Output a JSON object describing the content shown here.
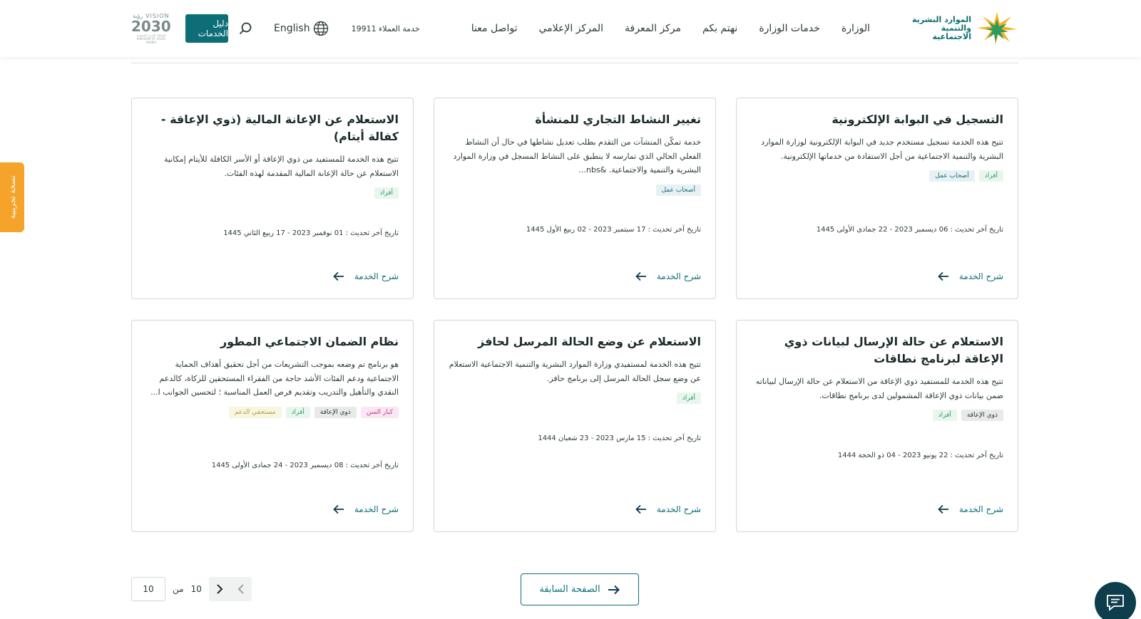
{
  "header": {
    "logo_text_line1": "الموارد البشرية",
    "logo_text_line2": "والتنمية الاجتماعية",
    "nav": [
      "الوزارة",
      "خدمات الوزارة",
      "نهتم بكم",
      "مركز المعرفة",
      "المركز الإعلامي",
      "تواصل معنا"
    ],
    "customer_service": "خدمة العملاء 19911",
    "language": "English",
    "guide_button": "دليل الخدمات",
    "vision_line1": "VISION رؤية",
    "vision_year": "2030",
    "vision_line3": "المملكة العربية السعودية KINGDOM OF SAUDI ARABIA"
  },
  "side_tab": "نسخة تجريبية",
  "service_link_label": "شرح الخدمة",
  "cards": [
    {
      "title": "التسجيل في البوابة الإلكترونية",
      "desc": "تتيح هذه الخدمة تسجيل مستخدم جديد في البوابة الإلكترونية لوزارة الموارد البشرية والتنمية الاجتماعية من أجل الاستفادة من خدماتها الإلكترونية.",
      "tags": [
        "أفراد",
        "أصحاب عمل"
      ],
      "date": "تاريخ آخر تحديث : 06 ديسمبر 2023 - 22 جمادى الأولى 1445"
    },
    {
      "title": "تغيير النشاط التجاري للمنشأة",
      "desc": "خدمة تمكّن المنشآت من التقدم بطلب تعديل نشاطها في حال أن النشاط الفعلي الحالي الذي تمارسه لا ينطبق على النشاط المسجل في وزارة الموارد البشرية والتنمية والاجتماعية. &nbs...",
      "tags": [
        "أصحاب عمل"
      ],
      "date": "تاريخ آخر تحديث : 17 سبتمبر 2023 - 02 ربيع الأول 1445"
    },
    {
      "title": "الاستعلام عن الإعانة المالية (ذوي الإعاقة - كفالة أيتام)",
      "desc": "تتيح هذه الخدمة للمستفيد من ذوي الإعاقة أو الأسر الكافلة للأيتام إمكانية الاستعلام عن حالة الإعانة المالية المقدمة لهذه الفئات.",
      "tags": [
        "أفراد"
      ],
      "date": "تاريخ آخر تحديث : 01 نوفمبر 2023 - 17 ربيع الثاني 1445"
    },
    {
      "title": "الاستعلام عن حالة الإرسال لبيانات ذوي الإعاقة لبرنامج نطاقات",
      "desc": "تتيح هذه الخدمة للمستفيد ذوي الإعاقة من الاستعلام عن حالة الإرسال لبياناته ضمن بيانات ذوي الإعاقة المشمولين لدى برنامج نطاقات.",
      "tags": [
        "ذوي الإعاقة",
        "أفراد"
      ],
      "date": "تاريخ آخر تحديث : 22 يونيو 2023 - 04 ذو الحجة 1444"
    },
    {
      "title": "الاستعلام عن وضع الحالة المرسل لحافز",
      "desc": "تتيح هذه الخدمة لمستفيدي وزارة الموارد البشرية والتنمية الاجتماعية الاستعلام عن وضع سجل الحالة المرسل إلى برنامج حافز.",
      "tags": [
        "أفراد"
      ],
      "date": "تاريخ آخر تحديث : 15 مارس 2023 - 23 شعبان 1444"
    },
    {
      "title": "نظام الضمان الاجتماعي المطور",
      "desc": "هو برنامج تم وضعه بموجب التشريعات من أجل تحقيق أهداف الحماية الاجتماعية ودعم الفئات الأشد حاجة من الفقراء المستحقين للزكاة، كالدعم النقدي والتأهيل والتدريب وتقديم فرص العمل المناسبة ؛ لتحسين الجوانب ا...",
      "tags": [
        "كبار السن",
        "ذوي الإعاقة",
        "أفراد",
        "مستحقي الدعم"
      ],
      "date": "تاريخ آخر تحديث : 08 ديسمبر 2023 - 24 جمادى الأولى 1445"
    }
  ],
  "pagination": {
    "prev_page_label": "الصفحة السابقة",
    "current_page": "10",
    "of_label": "من",
    "total_pages": "10"
  },
  "colors": {
    "primary": "#0d6e78",
    "accent_orange": "#f5a32b",
    "chat_bg": "#0e3d4c"
  }
}
